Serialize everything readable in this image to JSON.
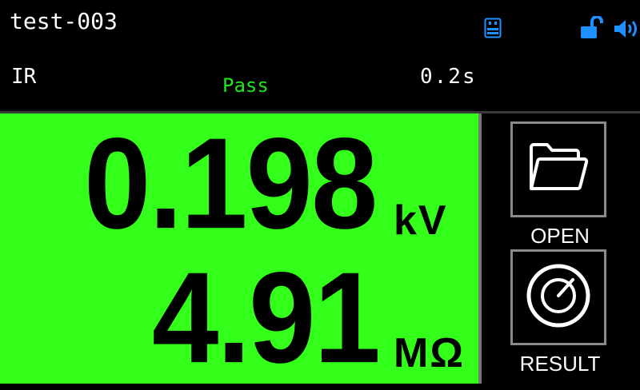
{
  "header": {
    "file_name": "test-003",
    "icons": [
      "usb-icon",
      "unlock-icon",
      "speaker-icon"
    ],
    "accent_color": "#1e90ff"
  },
  "status": {
    "mode": "IR",
    "judgement": "Pass",
    "judgement_color": "#1fe61f",
    "time": "0.2s"
  },
  "measurement": {
    "background_color": "#33ff1a",
    "voltage_value": "0.198",
    "voltage_unit": "kV",
    "resistance_value": "4.91",
    "resistance_unit": "MΩ"
  },
  "buttons": {
    "open_label": "OPEN",
    "result_label": "RESULT"
  }
}
